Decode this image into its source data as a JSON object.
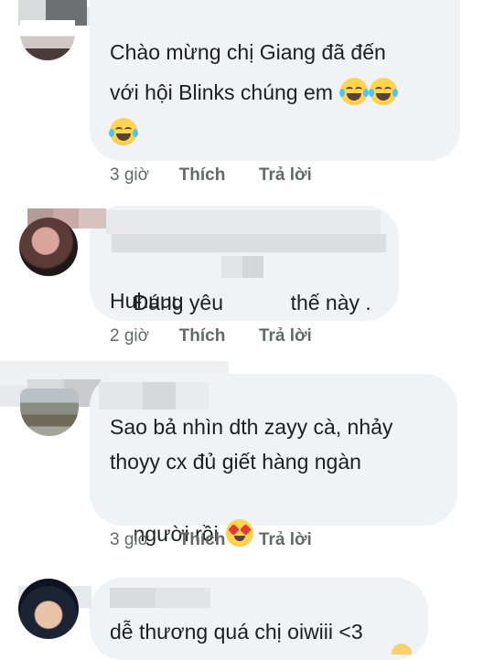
{
  "comments": [
    {
      "line1": "Chào mừng chị Giang đã đến",
      "line2": "với hội Blinks chúng em",
      "time": "3 giờ",
      "like": "Thích",
      "reply": "Trả lời",
      "emojis": [
        "laugh-cry-emoji",
        "laugh-cry-emoji",
        "laugh-cry-emoji"
      ]
    },
    {
      "line1a": "Đáng yêu",
      "line1b": "thế này .",
      "line2": "Huhuuu",
      "time": "2 giờ",
      "like": "Thích",
      "reply": "Trả lời"
    },
    {
      "line1": "Sao bả nhìn dth zayy cà, nhảy",
      "line2": "thoyy cx đủ giết hàng ngàn",
      "line3": "người rồi",
      "time": "3 giờ",
      "like": "Thích",
      "reply": "Trả lời",
      "emojis": [
        "heart-eyes-emoji"
      ]
    },
    {
      "line1": "dễ thương quá chị oiwiii <3"
    }
  ],
  "colors": {
    "bubble": "#f0f2f5",
    "text": "#1c1e21",
    "meta": "#65676b"
  }
}
